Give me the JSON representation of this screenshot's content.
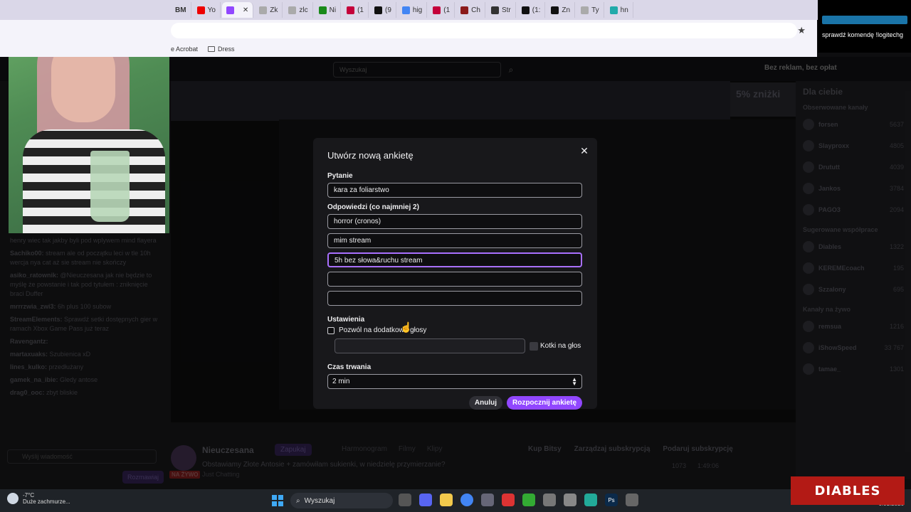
{
  "browser": {
    "tabs": [
      {
        "label": "Zk",
        "color": "#aaa"
      },
      {
        "label": "zlc",
        "color": "#aaa"
      },
      {
        "label": "Ni",
        "color": "#1a8a1a"
      },
      {
        "label": "(1",
        "color": "#c4003a"
      },
      {
        "label": "(9",
        "color": "#111"
      },
      {
        "label": "hig",
        "color": "#4285f4"
      },
      {
        "label": "(1",
        "color": "#c4003a"
      },
      {
        "label": "Ch",
        "color": "#8b1a1a"
      },
      {
        "label": "Str",
        "color": "#333"
      },
      {
        "label": "(1:",
        "color": "#111"
      },
      {
        "label": "Zn",
        "color": "#111"
      },
      {
        "label": "Ty",
        "color": "#aaa"
      },
      {
        "label": "hn",
        "color": "#2aa"
      }
    ],
    "tab_bm": "BM",
    "tab_yt": "Yo",
    "bookmarks": [
      {
        "label": "e Acrobat"
      },
      {
        "label": "Dress"
      }
    ],
    "star_icon": "★"
  },
  "overlay_cmd": {
    "text": "sprawdź komendę !logitechg"
  },
  "twitch": {
    "search_placeholder": "Wyszukaj",
    "adfree": "Bez reklam, bez opłat",
    "promo": "5% zniżki",
    "sidebar": {
      "title": "Dla ciebie",
      "followed": "Obserwowane kanały",
      "channels": [
        {
          "name": "forsen",
          "count": "5637"
        },
        {
          "name": "Slayproxx",
          "count": "4805"
        },
        {
          "name": "Drututt",
          "count": "4039"
        },
        {
          "name": "Jankos",
          "count": "3784"
        },
        {
          "name": "PAGO3",
          "count": "2094"
        }
      ],
      "recommended": "Sugerowane współprace",
      "rec_channels": [
        {
          "name": "Diables",
          "count": "1322"
        },
        {
          "name": "KEREMEcoach",
          "count": "195"
        },
        {
          "name": "Szzalony",
          "count": "695"
        }
      ],
      "live": "Kanały na żywo",
      "live_channels": [
        {
          "name": "remsua",
          "count": "1216"
        },
        {
          "name": "iShowSpeed",
          "count": "33 767"
        },
        {
          "name": "tamae_",
          "count": "1301"
        }
      ]
    },
    "chat": [
      {
        "user": "",
        "text": "henry wiec tak jakby byli pod wplywem mind flayera"
      },
      {
        "user": "Sachiko00:",
        "text": "stream ale od początku leci w tle 10h wercja nya cat aż sie stream nie skończy"
      },
      {
        "user": "asiko_ratownik:",
        "text": "@Nieuczesana jak nie będzie to myślę że powstanie i tak pod tytułem : zniknięcie braci Duffer"
      },
      {
        "user": "mrrrzwia_zwi3:",
        "text": "6h plus 100 subow"
      },
      {
        "user": "StreamElements:",
        "text": "Sprawdź setki dostępnych gier w ramach Xbox Game Pass już teraz"
      },
      {
        "user": "Ravengantz:",
        "text": ""
      },
      {
        "user": "martaxuaks:",
        "text": "Szubienica xD"
      },
      {
        "user": "lines_kulko:",
        "text": "przedłużany"
      },
      {
        "user": "gamek_na_ibie:",
        "text": "Gledy antose"
      },
      {
        "user": "drag0_ooc:",
        "text": "zbyt bliskie"
      }
    ],
    "chat_placeholder": "Wyślij wiadomość",
    "chat_button": "Rozmawiaj",
    "channel": {
      "name": "Nieuczesana",
      "follow": "Zapukaj",
      "title": "Obstawiamy Złote Antosie + zamówiłam sukienki, w niedzielę przymierzanie?",
      "game": "Just Chatting",
      "live": "NA ŻYWO",
      "tabs": [
        "Harmonogram",
        "Filmy",
        "Klipy"
      ],
      "actions": [
        "Kup Bitsy",
        "Zarządzaj subskrypcją",
        "Podaruj subskrypcję"
      ],
      "viewers": "1073",
      "uptime": "1:49:06"
    }
  },
  "modal": {
    "title": "Utwórz nową ankietę",
    "question_label": "Pytanie",
    "question_value": "kara za foliarstwo",
    "answers_label": "Odpowiedzi (co najmniej 2)",
    "answers": [
      "horror (cronos)",
      "mim stream",
      "5h bez słowa&ruchu stream",
      "",
      ""
    ],
    "settings_label": "Ustawienia",
    "extra_votes_label": "Pozwól na dodatkowe głosy",
    "bits_label": "Kotki na głos",
    "duration_label": "Czas trwania",
    "duration_value": "2 min",
    "cancel": "Anuluj",
    "start": "Rozpocznij ankietę"
  },
  "taskbar": {
    "temp": "-7°C",
    "weather": "Duże zachmurze...",
    "search": "Wyszukaj",
    "date": "6.01.2026"
  },
  "brand": "DIABLES"
}
